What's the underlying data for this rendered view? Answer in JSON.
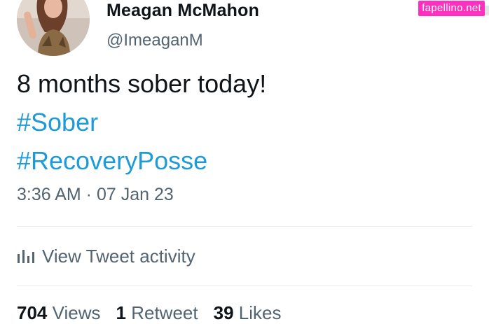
{
  "user": {
    "display_name": "Meagan McMahon",
    "handle": "@ImeaganM",
    "avatar_icon": "profile-photo"
  },
  "watermark": {
    "text": "fapellino.net",
    "color": "#ff2fbf"
  },
  "tweet": {
    "text": "8 months sober today!",
    "hashtags": [
      "#Sober",
      "#RecoveryPosse"
    ],
    "timestamp": "3:36 AM · 07 Jan 23",
    "hashtag_color": "#1d9bd8"
  },
  "activity": {
    "label": "View Tweet activity",
    "icon": "bar-chart-icon"
  },
  "stats": {
    "views_count": "704",
    "views_label": "Views",
    "retweets_count": "1",
    "retweets_label": "Retweet",
    "likes_count": "39",
    "likes_label": "Likes"
  }
}
